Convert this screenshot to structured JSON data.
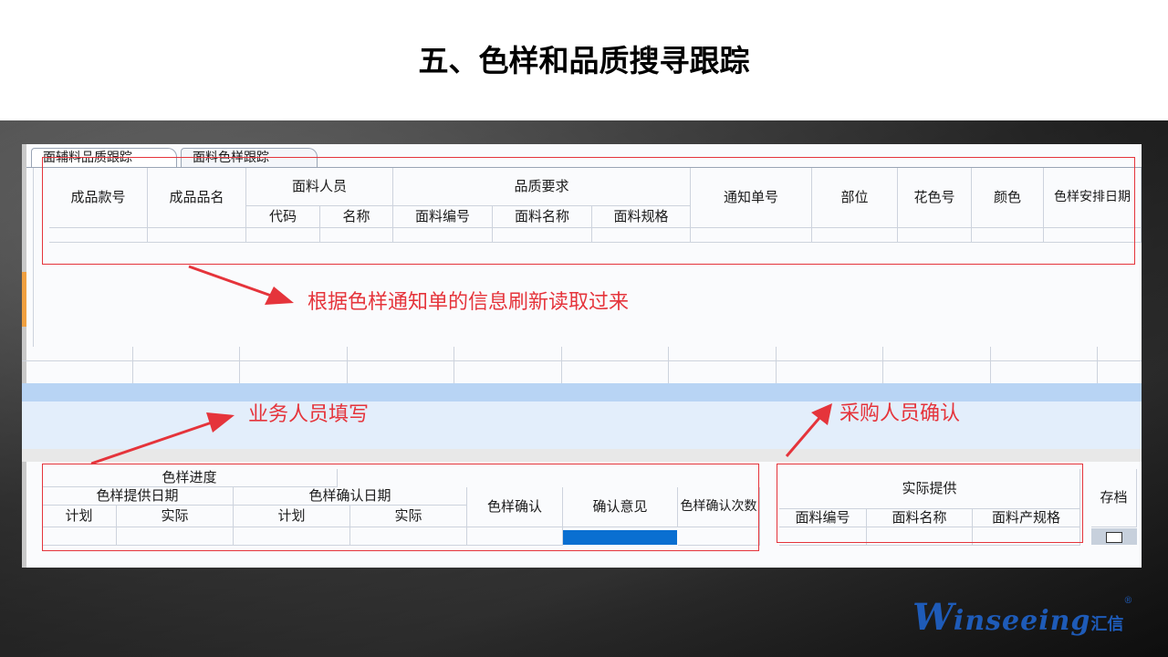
{
  "slide": {
    "title": "五、色样和品质搜寻跟踪"
  },
  "tabs": [
    "面辅料品质跟踪",
    "面料色样跟踪"
  ],
  "upper_grid": {
    "product_no": "成品款号",
    "product_name": "成品品名",
    "fabric_staff": "面料人员",
    "staff_code": "代码",
    "staff_name": "名称",
    "quality_req": "品质要求",
    "fabric_no": "面料编号",
    "fabric_name": "面料名称",
    "fabric_spec": "面料规格",
    "notice_no": "通知单号",
    "part": "部位",
    "pattern_no": "花色号",
    "color": "颜色",
    "color_sample_date": "色样安排日期"
  },
  "lower_grid": {
    "progress": "色样进度",
    "provide_date": "色样提供日期",
    "plan": "计划",
    "actual": "实际",
    "confirm_date": "色样确认日期",
    "confirm": "色样确认",
    "opinion": "确认意见",
    "confirm_times": "色样确认次数",
    "actual_supply": "实际提供",
    "fabric_no": "面料编号",
    "fabric_name": "面料名称",
    "fabric_product_spec": "面料产规格",
    "archive": "存档"
  },
  "annotations": {
    "refresh_note": "根据色样通知单的信息刷新读取过来",
    "sales_note": "业务人员填写",
    "purchase_note": "采购人员确认"
  },
  "logo": {
    "w": "W",
    "rest": "inseeing",
    "cn": "汇信",
    "reg": "®"
  },
  "colors": {
    "annotation_red": "#e5343b",
    "selected_blue": "#0a6fd1",
    "band_blue": "#b8d4f4",
    "logo_blue": "#1e5bb8"
  }
}
